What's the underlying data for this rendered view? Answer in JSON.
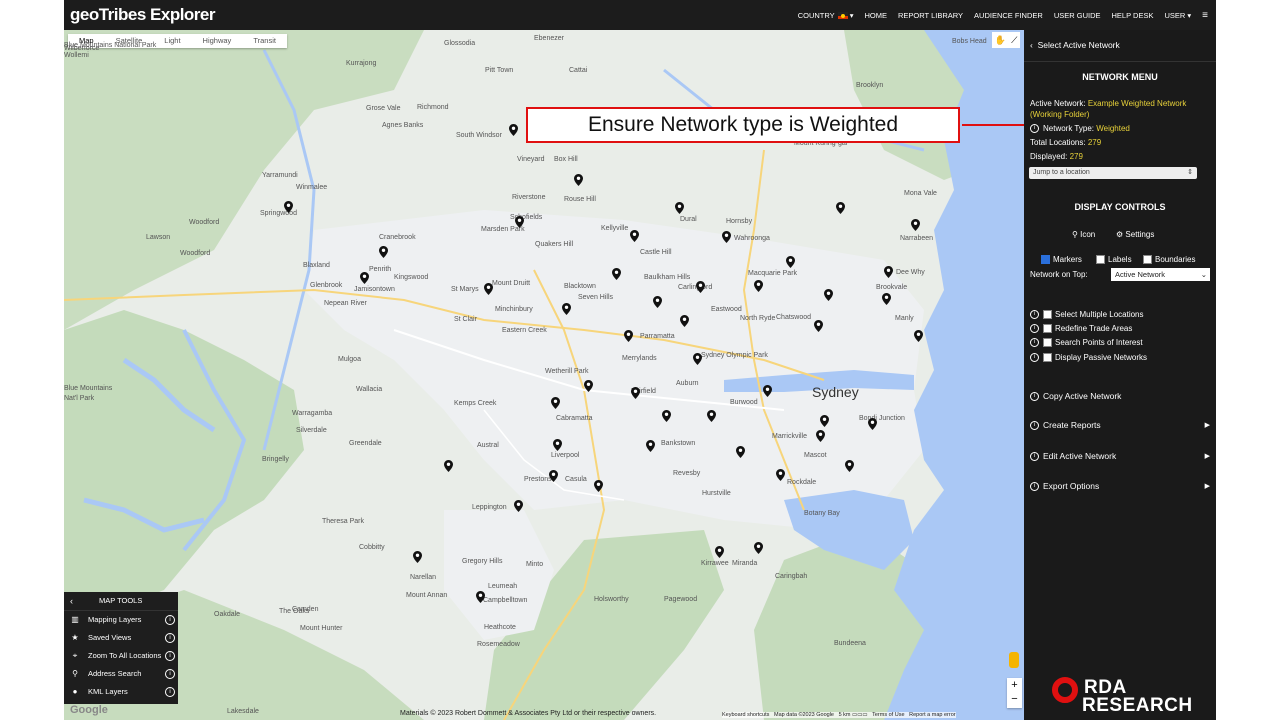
{
  "app": {
    "title": "geoTribes Explorer"
  },
  "nav": {
    "country": "COUNTRY",
    "home": "HOME",
    "report_library": "REPORT LIBRARY",
    "audience_finder": "AUDIENCE FINDER",
    "user_guide": "USER GUIDE",
    "help_desk": "HELP DESK",
    "user": "USER ▾",
    "menu_icon": "hamburger-icon"
  },
  "map": {
    "types": [
      "Map",
      "Satellite",
      "Light",
      "Highway",
      "Transit"
    ],
    "active_type": "Map",
    "city_label": "Sydney",
    "places": [
      "Glossodia",
      "Ebenezer",
      "Kurrajong",
      "Wilberforce",
      "Pitt Town",
      "Cattai",
      "Blue Mountains National Park",
      "Wollemi",
      "Richmond",
      "Agnes Banks",
      "South Windsor",
      "Brooklyn",
      "Mount Kuring-gai",
      "Box Hill",
      "Vineyard",
      "Yarramundi",
      "Rouse Hill",
      "Riverstone",
      "Winmalee",
      "Springwood",
      "Schofields",
      "Marsden Park",
      "Dural",
      "Mona Vale",
      "Kellyville",
      "Hornsby",
      "Woodford",
      "Lawson",
      "Cranebrook",
      "Quakers Hill",
      "Castle Hill",
      "Wahroonga",
      "Narrabeen",
      "Woodford",
      "Blaxland",
      "Penrith",
      "Kingswood",
      "Glenbrook",
      "Jamisontown",
      "St Marys",
      "Mount Druitt",
      "Blacktown",
      "Baulkham Hills",
      "Seven Hills",
      "Carlingford",
      "Macquarie Park",
      "Brookvale",
      "Dee Why",
      "Minchinbury",
      "Eastwood",
      "North Ryde",
      "Chatswood",
      "St Clair",
      "Eastern Creek",
      "Manly",
      "Parramatta",
      "Merrylands",
      "Sydney Olympic Park",
      "Mulgoa",
      "Wetherill Park",
      "Auburn",
      "Burwood",
      "Blue Mountains",
      "Nat'l Park",
      "Wallacia",
      "Fairfield",
      "Bondi Junction",
      "Warragamba",
      "Kemps Creek",
      "Cabramatta",
      "Marrickville",
      "Silverdale",
      "Greendale",
      "Austral",
      "Bankstown",
      "Mascot",
      "Bringelly",
      "Liverpool",
      "Revesby",
      "Rockdale",
      "Prestons",
      "Casula",
      "Hurstville",
      "Leppington",
      "Botany Bay",
      "Theresa Park",
      "Cobbitty",
      "Minto",
      "Kirrawee",
      "Miranda",
      "Narellan",
      "Gregory Hills",
      "Caringbah",
      "Mount Annan",
      "Leumeah",
      "Campbelltown",
      "Holsworthy",
      "Camden",
      "Oakdale",
      "Pagewood",
      "The Oaks",
      "Mount Hunter",
      "Rosemeadow",
      "Lakesdale",
      "Heathcote",
      "Bundeena",
      "Nepean River",
      "Bobs Head",
      "Grose Vale"
    ],
    "markers_count": 48,
    "copyright": "Materials © 2023 Robert Dommett & Associates Pty Ltd or their respective owners.",
    "attribution": [
      "Keyboard shortcuts",
      "Map data ©2023 Google",
      "5 km",
      "Terms of Use",
      "Report a map error"
    ],
    "google_logo": "Google",
    "zoom_in": "+",
    "zoom_out": "−"
  },
  "callout": {
    "text": "Ensure Network type is Weighted"
  },
  "map_tools": {
    "title": "MAP TOOLS",
    "items": [
      {
        "icon": "map-icon",
        "label": "Mapping Layers"
      },
      {
        "icon": "star-icon",
        "label": "Saved Views"
      },
      {
        "icon": "binoculars-icon",
        "label": "Zoom To All Locations"
      },
      {
        "icon": "search-icon",
        "label": "Address Search"
      },
      {
        "icon": "globe-icon",
        "label": "KML Layers"
      }
    ]
  },
  "side": {
    "select_network": "Select Active Network",
    "network_menu": "NETWORK MENU",
    "active_network_label": "Active Network:",
    "active_network_value": "Example Weighted Network",
    "active_network_folder": "(Working Folder)",
    "network_type_label": "Network Type:",
    "network_type_value": "Weighted",
    "total_locations_label": "Total Locations:",
    "total_locations_value": "279",
    "displayed_label": "Displayed:",
    "displayed_value": "279",
    "jump_placeholder": "Jump to a location",
    "display_controls": "DISPLAY CONTROLS",
    "icon_label": "Icon",
    "settings_label": "Settings",
    "markers_label": "Markers",
    "labels_label": "Labels",
    "boundaries_label": "Boundaries",
    "network_on_top_label": "Network on Top:",
    "network_on_top_value": "Active Network",
    "options": [
      "Select Multiple Locations",
      "Redefine Trade Areas",
      "Search Points of Interest",
      "Display Passive Networks"
    ],
    "copy_network": "Copy Active Network",
    "create_reports": "Create Reports",
    "edit_network": "Edit Active Network",
    "export_options": "Export Options"
  },
  "brand": {
    "line1": "RDA",
    "line2": "RESEARCH",
    "accent": "#e01010"
  },
  "colors": {
    "topbar": "#1c1c1c",
    "panel": "#1a1a1a",
    "highlight": "#e8d23a",
    "water": "#aac8f5",
    "park": "#c6dcbd",
    "urban": "#eef0f2"
  }
}
